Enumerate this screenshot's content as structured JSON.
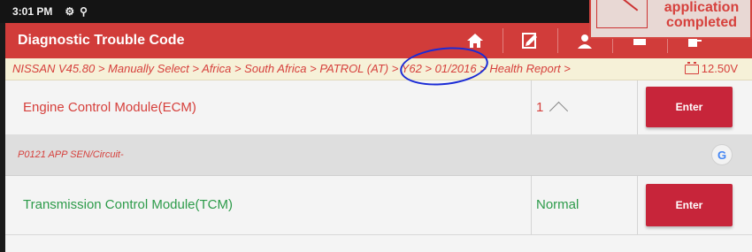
{
  "status_bar": {
    "time": "3:01 PM",
    "icons": [
      "settings-gear-icon",
      "usb-debug-icon"
    ]
  },
  "notice": {
    "text_line1": "application",
    "text_line2": "completed"
  },
  "header": {
    "title": "Diagnostic Trouble Code",
    "buttons": [
      "home-icon",
      "report-icon",
      "user-icon",
      "print-icon",
      "exit-icon"
    ]
  },
  "breadcrumb": {
    "path": "NISSAN V45.80 > Manually Select > Africa > South Africa > PATROL (AT) > Y62 > 01/2016 > Health Report >",
    "voltage": "12.50V"
  },
  "modules": [
    {
      "name": "Engine Control Module(ECM)",
      "status": "1",
      "enter_label": "Enter"
    },
    {
      "name": "Transmission Control Module(TCM)",
      "status": "Normal",
      "enter_label": "Enter"
    }
  ],
  "dtc": {
    "code_text": "P0121 APP SEN/Circuit-",
    "search_label": "G"
  },
  "colors": {
    "header": "#d13c3a",
    "accent_red": "#d6403c",
    "ok_green": "#2d9b4a",
    "enter_button": "#c7253a"
  }
}
